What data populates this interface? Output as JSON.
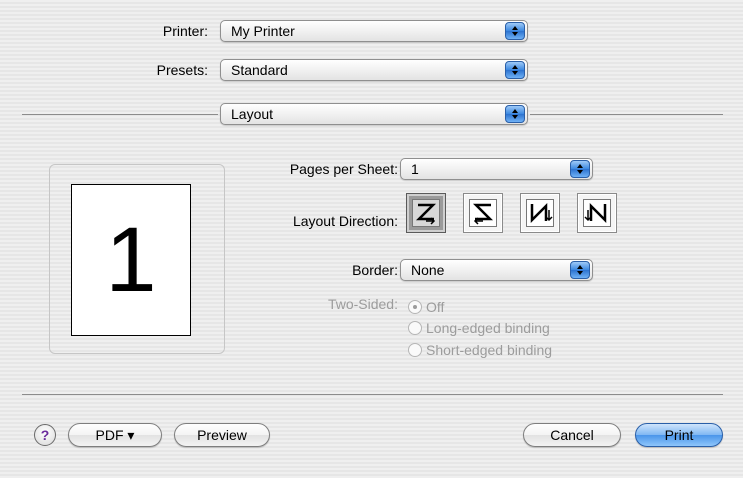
{
  "printer": {
    "label": "Printer:",
    "value": "My Printer"
  },
  "presets": {
    "label": "Presets:",
    "value": "Standard"
  },
  "pane": {
    "value": "Layout"
  },
  "preview": {
    "page_number": "1"
  },
  "layout": {
    "pages_per_sheet": {
      "label": "Pages per Sheet:",
      "value": "1"
    },
    "direction": {
      "label": "Layout Direction:",
      "options": [
        {
          "icon": "z-left-right-icon",
          "selected": true
        },
        {
          "icon": "s-right-left-icon",
          "selected": false
        },
        {
          "icon": "n-top-bottom-left-icon",
          "selected": false
        },
        {
          "icon": "n-top-bottom-right-icon",
          "selected": false
        }
      ]
    },
    "border": {
      "label": "Border:",
      "value": "None"
    },
    "two_sided": {
      "label": "Two-Sided:",
      "options": [
        "Off",
        "Long-edged binding",
        "Short-edged binding"
      ],
      "selected": "Off",
      "enabled": false
    }
  },
  "buttons": {
    "help": "?",
    "pdf": "PDF ▾",
    "preview": "Preview",
    "cancel": "Cancel",
    "print": "Print"
  },
  "colors": {
    "accent": "#3a87e0",
    "disabled_text": "#9c9c9c"
  }
}
